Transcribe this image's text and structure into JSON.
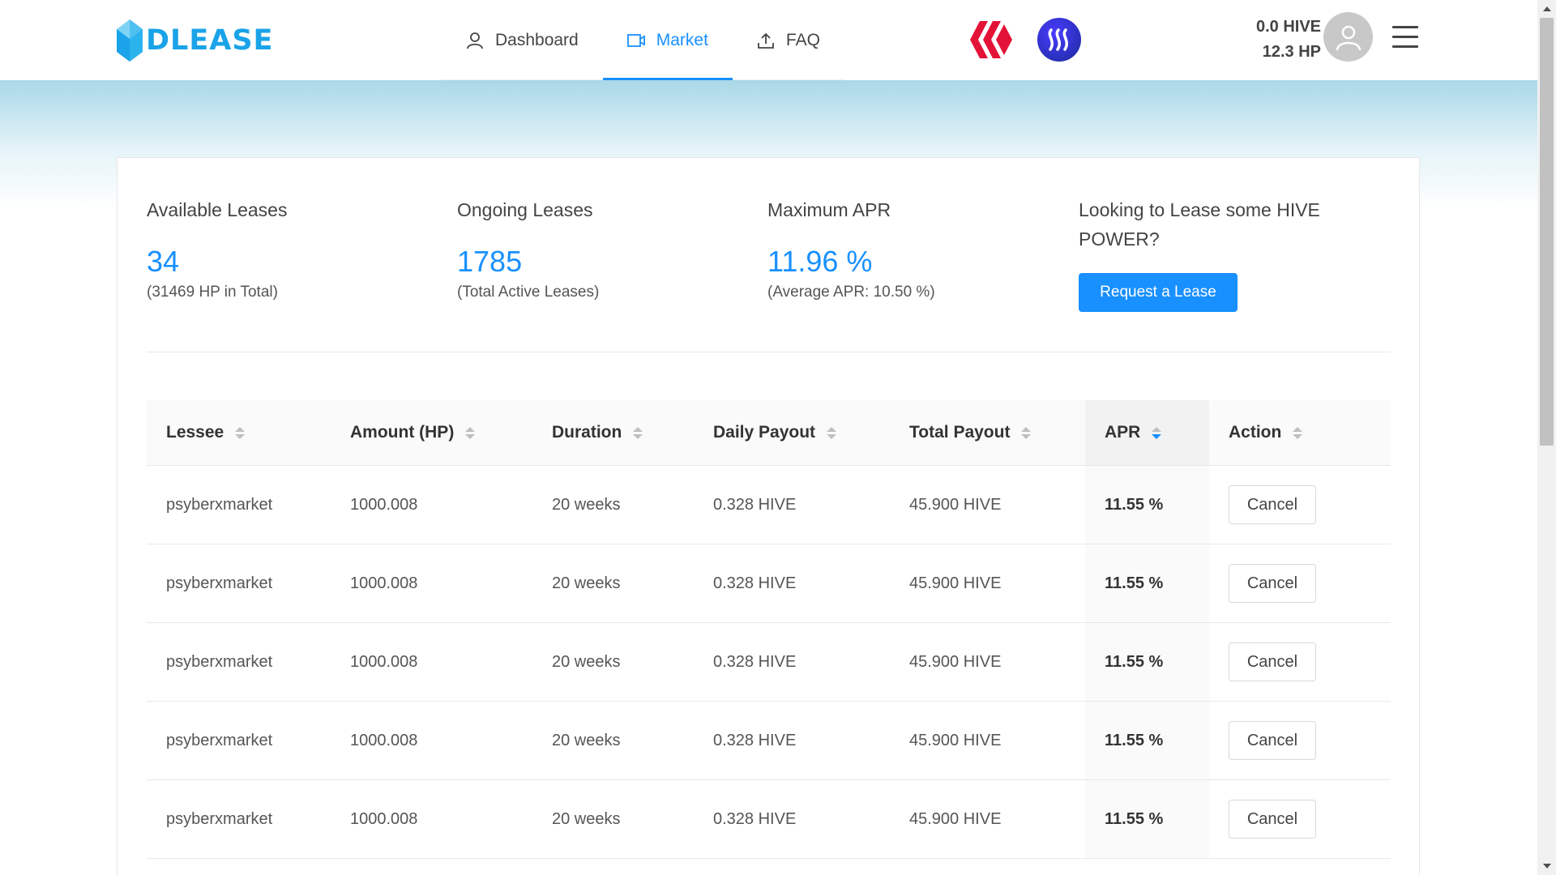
{
  "header": {
    "logo_text": "DLEASE",
    "nav": [
      {
        "label": "Dashboard",
        "icon": "user-icon",
        "active": false
      },
      {
        "label": "Market",
        "icon": "video-icon",
        "active": true
      },
      {
        "label": "FAQ",
        "icon": "upload-icon",
        "active": false
      }
    ],
    "chains": [
      "hive-logo-icon",
      "steem-logo-icon"
    ],
    "balance_hive": "0.0 HIVE",
    "balance_hp": "12.3 HP",
    "colors": {
      "accent": "#1890ff",
      "logo": "#1aa3e8",
      "hive": "#e31337",
      "steem": "#2a2fc8",
      "band": "#a9d8e8"
    }
  },
  "stats": {
    "available": {
      "title": "Available Leases",
      "value": "34",
      "sub": "(31469 HP in Total)"
    },
    "ongoing": {
      "title": "Ongoing Leases",
      "value": "1785",
      "sub": "(Total Active Leases)"
    },
    "max_apr": {
      "title": "Maximum APR",
      "value": "11.96 %",
      "sub": "(Average APR: 10.50 %)"
    },
    "request": {
      "title": "Looking to Lease some HIVE POWER?",
      "button": "Request a Lease"
    }
  },
  "table": {
    "columns": [
      "Lessee",
      "Amount (HP)",
      "Duration",
      "Daily Payout",
      "Total Payout",
      "APR",
      "Action"
    ],
    "sorted_column": "APR",
    "rows": [
      {
        "lessee": "psyberxmarket",
        "amount": "1000.008",
        "duration": "20 weeks",
        "daily": "0.328 HIVE",
        "total": "45.900 HIVE",
        "apr": "11.55 %",
        "action": "Cancel"
      },
      {
        "lessee": "psyberxmarket",
        "amount": "1000.008",
        "duration": "20 weeks",
        "daily": "0.328 HIVE",
        "total": "45.900 HIVE",
        "apr": "11.55 %",
        "action": "Cancel"
      },
      {
        "lessee": "psyberxmarket",
        "amount": "1000.008",
        "duration": "20 weeks",
        "daily": "0.328 HIVE",
        "total": "45.900 HIVE",
        "apr": "11.55 %",
        "action": "Cancel"
      },
      {
        "lessee": "psyberxmarket",
        "amount": "1000.008",
        "duration": "20 weeks",
        "daily": "0.328 HIVE",
        "total": "45.900 HIVE",
        "apr": "11.55 %",
        "action": "Cancel"
      },
      {
        "lessee": "psyberxmarket",
        "amount": "1000.008",
        "duration": "20 weeks",
        "daily": "0.328 HIVE",
        "total": "45.900 HIVE",
        "apr": "11.55 %",
        "action": "Cancel"
      }
    ]
  }
}
